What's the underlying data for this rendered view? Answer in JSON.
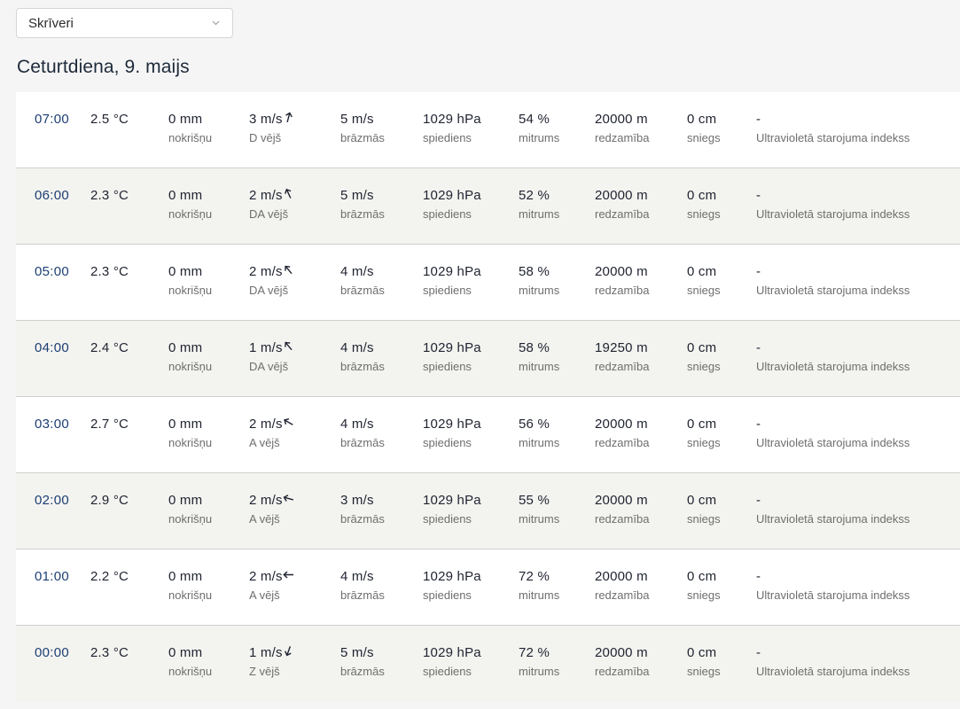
{
  "location_select": {
    "value": "Skrīveri",
    "icon": "chevron-down-icon"
  },
  "day_title": "Ceturtdiena, 9. maijs",
  "rows": [
    {
      "time": "07:00",
      "temp": "2.5 °C",
      "precip": "0 mm",
      "precip_label": "nokrišņu",
      "wind": "3 m/s",
      "wind_dir_deg": 15,
      "wind_label": "D vējš",
      "gust": "5 m/s",
      "gust_label": "brāzmās",
      "pressure": "1029 hPa",
      "pressure_label": "spiediens",
      "humidity": "54 %",
      "humidity_label": "mitrums",
      "visibility": "20000 m",
      "visibility_label": "redzamība",
      "snow": "0 cm",
      "snow_label": "sniegs",
      "uv": "-",
      "uv_label": "Ultravioletā starojuma indekss"
    },
    {
      "time": "06:00",
      "temp": "2.3 °C",
      "precip": "0 mm",
      "precip_label": "nokrišņu",
      "wind": "2 m/s",
      "wind_dir_deg": -25,
      "wind_label": "DA vējš",
      "gust": "5 m/s",
      "gust_label": "brāzmās",
      "pressure": "1029 hPa",
      "pressure_label": "spiediens",
      "humidity": "52 %",
      "humidity_label": "mitrums",
      "visibility": "20000 m",
      "visibility_label": "redzamība",
      "snow": "0 cm",
      "snow_label": "sniegs",
      "uv": "-",
      "uv_label": "Ultravioletā starojuma indekss"
    },
    {
      "time": "05:00",
      "temp": "2.3 °C",
      "precip": "0 mm",
      "precip_label": "nokrišņu",
      "wind": "2 m/s",
      "wind_dir_deg": -40,
      "wind_label": "DA vējš",
      "gust": "4 m/s",
      "gust_label": "brāzmās",
      "pressure": "1029 hPa",
      "pressure_label": "spiediens",
      "humidity": "58 %",
      "humidity_label": "mitrums",
      "visibility": "20000 m",
      "visibility_label": "redzamība",
      "snow": "0 cm",
      "snow_label": "sniegs",
      "uv": "-",
      "uv_label": "Ultravioletā starojuma indekss"
    },
    {
      "time": "04:00",
      "temp": "2.4 °C",
      "precip": "0 mm",
      "precip_label": "nokrišņu",
      "wind": "1 m/s",
      "wind_dir_deg": -40,
      "wind_label": "DA vējš",
      "gust": "4 m/s",
      "gust_label": "brāzmās",
      "pressure": "1029 hPa",
      "pressure_label": "spiediens",
      "humidity": "58 %",
      "humidity_label": "mitrums",
      "visibility": "19250 m",
      "visibility_label": "redzamība",
      "snow": "0 cm",
      "snow_label": "sniegs",
      "uv": "-",
      "uv_label": "Ultravioletā starojuma indekss"
    },
    {
      "time": "03:00",
      "temp": "2.7 °C",
      "precip": "0 mm",
      "precip_label": "nokrišņu",
      "wind": "2 m/s",
      "wind_dir_deg": -60,
      "wind_label": "A vējš",
      "gust": "4 m/s",
      "gust_label": "brāzmās",
      "pressure": "1029 hPa",
      "pressure_label": "spiediens",
      "humidity": "56 %",
      "humidity_label": "mitrums",
      "visibility": "20000 m",
      "visibility_label": "redzamība",
      "snow": "0 cm",
      "snow_label": "sniegs",
      "uv": "-",
      "uv_label": "Ultravioletā starojuma indekss"
    },
    {
      "time": "02:00",
      "temp": "2.9 °C",
      "precip": "0 mm",
      "precip_label": "nokrišņu",
      "wind": "2 m/s",
      "wind_dir_deg": -75,
      "wind_label": "A vējš",
      "gust": "3 m/s",
      "gust_label": "brāzmās",
      "pressure": "1029 hPa",
      "pressure_label": "spiediens",
      "humidity": "55 %",
      "humidity_label": "mitrums",
      "visibility": "20000 m",
      "visibility_label": "redzamība",
      "snow": "0 cm",
      "snow_label": "sniegs",
      "uv": "-",
      "uv_label": "Ultravioletā starojuma indekss"
    },
    {
      "time": "01:00",
      "temp": "2.2 °C",
      "precip": "0 mm",
      "precip_label": "nokrišņu",
      "wind": "2 m/s",
      "wind_dir_deg": -90,
      "wind_label": "A vējš",
      "gust": "4 m/s",
      "gust_label": "brāzmās",
      "pressure": "1029 hPa",
      "pressure_label": "spiediens",
      "humidity": "72 %",
      "humidity_label": "mitrums",
      "visibility": "20000 m",
      "visibility_label": "redzamība",
      "snow": "0 cm",
      "snow_label": "sniegs",
      "uv": "-",
      "uv_label": "Ultravioletā starojuma indekss"
    },
    {
      "time": "00:00",
      "temp": "2.3 °C",
      "precip": "0 mm",
      "precip_label": "nokrišņu",
      "wind": "1 m/s",
      "wind_dir_deg": 200,
      "wind_label": "Z vējš",
      "gust": "5 m/s",
      "gust_label": "brāzmās",
      "pressure": "1029 hPa",
      "pressure_label": "spiediens",
      "humidity": "72 %",
      "humidity_label": "mitrums",
      "visibility": "20000 m",
      "visibility_label": "redzamība",
      "snow": "0 cm",
      "snow_label": "sniegs",
      "uv": "-",
      "uv_label": "Ultravioletā starojuma indekss"
    }
  ],
  "colors": {
    "time_link": "#1c3f73",
    "row_odd": "#ffffff",
    "row_even": "#f3f3f0",
    "label_gray": "#6e6e6e"
  }
}
